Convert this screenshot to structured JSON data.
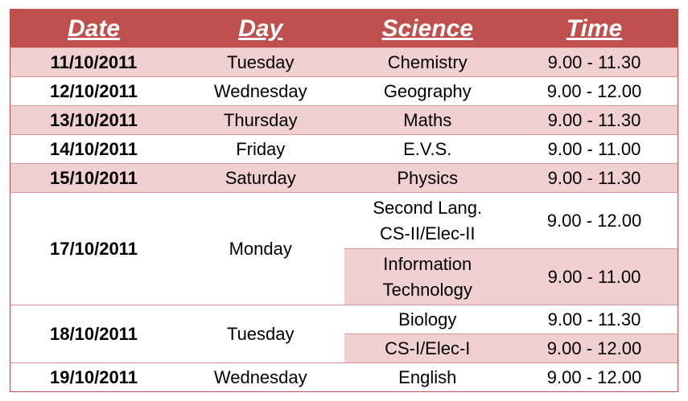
{
  "headers": {
    "date": "Date",
    "day": "Day",
    "science": "Science",
    "time": "Time"
  },
  "rows": [
    {
      "date": "11/10/2011",
      "day": "Tuesday",
      "science": "Chemistry",
      "time": "9.00 - 11.30"
    },
    {
      "date": "12/10/2011",
      "day": "Wednesday",
      "science": "Geography",
      "time": "9.00 - 12.00"
    },
    {
      "date": "13/10/2011",
      "day": "Thursday",
      "science": "Maths",
      "time": "9.00 - 11.30"
    },
    {
      "date": "14/10/2011",
      "day": "Friday",
      "science": "E.V.S.",
      "time": "9.00 - 11.00"
    },
    {
      "date": "15/10/2011",
      "day": "Saturday",
      "science": "Physics",
      "time": "9.00 - 11.30"
    },
    {
      "date": "17/10/2011",
      "day": "Monday",
      "subjects": [
        {
          "science_line1": "Second Lang.",
          "science_line2": "CS-II/Elec-II",
          "time": "9.00 - 12.00"
        },
        {
          "science_line1": "Information",
          "science_line2": "Technology",
          "time": "9.00 - 11.00"
        }
      ]
    },
    {
      "date": "18/10/2011",
      "day": "Tuesday",
      "subjects": [
        {
          "science": "Biology",
          "time": "9.00 - 11.30"
        },
        {
          "science": "CS-I/Elec-I",
          "time": "9.00 - 12.00"
        }
      ]
    },
    {
      "date": "19/10/2011",
      "day": "Wednesday",
      "science": "English",
      "time": "9.00 - 12.00"
    }
  ],
  "colors": {
    "header": "#c0504d",
    "shade": "#f0d0d0",
    "border": "#d99594"
  }
}
